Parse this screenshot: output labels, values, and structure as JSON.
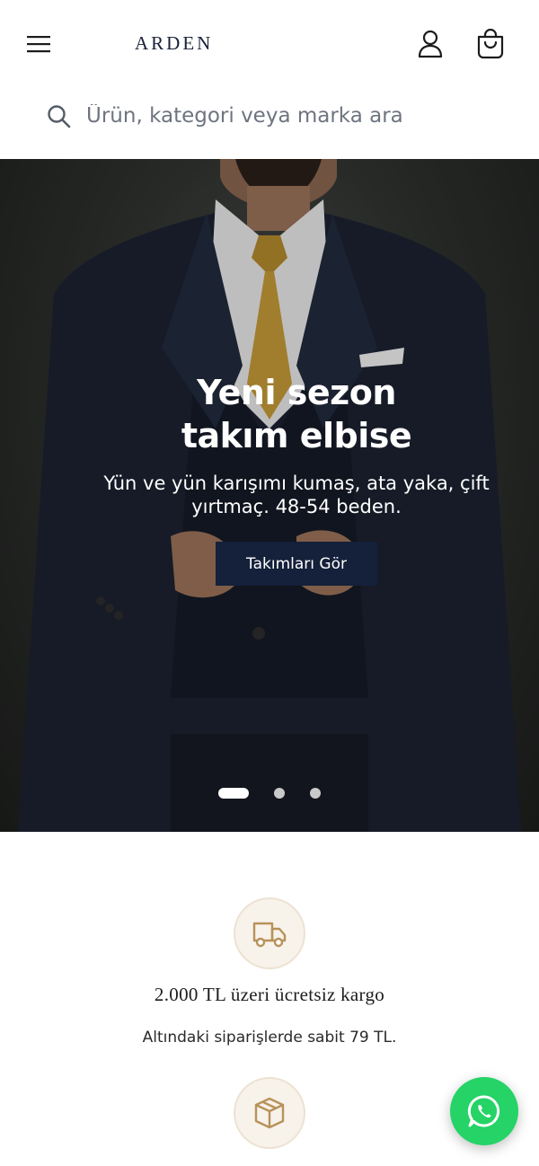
{
  "header": {
    "logo": "ARDEN",
    "menu_icon": "hamburger-menu-icon",
    "account_icon": "user-icon",
    "cart_icon": "shopping-bag-icon"
  },
  "search": {
    "placeholder": "Ürün, kategori veya marka ara",
    "icon": "search-icon"
  },
  "hero": {
    "title_line1": "Yeni sezon",
    "title_line2": "takım elbise",
    "subtitle": "Yün ve yün karışımı kumaş, ata yaka, çift yırtmaç. 48-54 beden.",
    "cta_label": "Takımları Gör",
    "slides_total": 3,
    "active_slide": 1
  },
  "features": [
    {
      "icon": "truck-icon",
      "title": "2.000 TL üzeri ücretsiz kargo",
      "description": "Altındaki siparişlerde sabit 79 TL."
    },
    {
      "icon": "package-box-icon",
      "title": "",
      "description": ""
    }
  ],
  "floating": {
    "whatsapp_icon": "whatsapp-icon"
  },
  "colors": {
    "brand_navy": "#15203a",
    "accent_gold": "#b8925a",
    "icon_bg": "#f7f2ea",
    "whatsapp_green": "#25d366"
  }
}
